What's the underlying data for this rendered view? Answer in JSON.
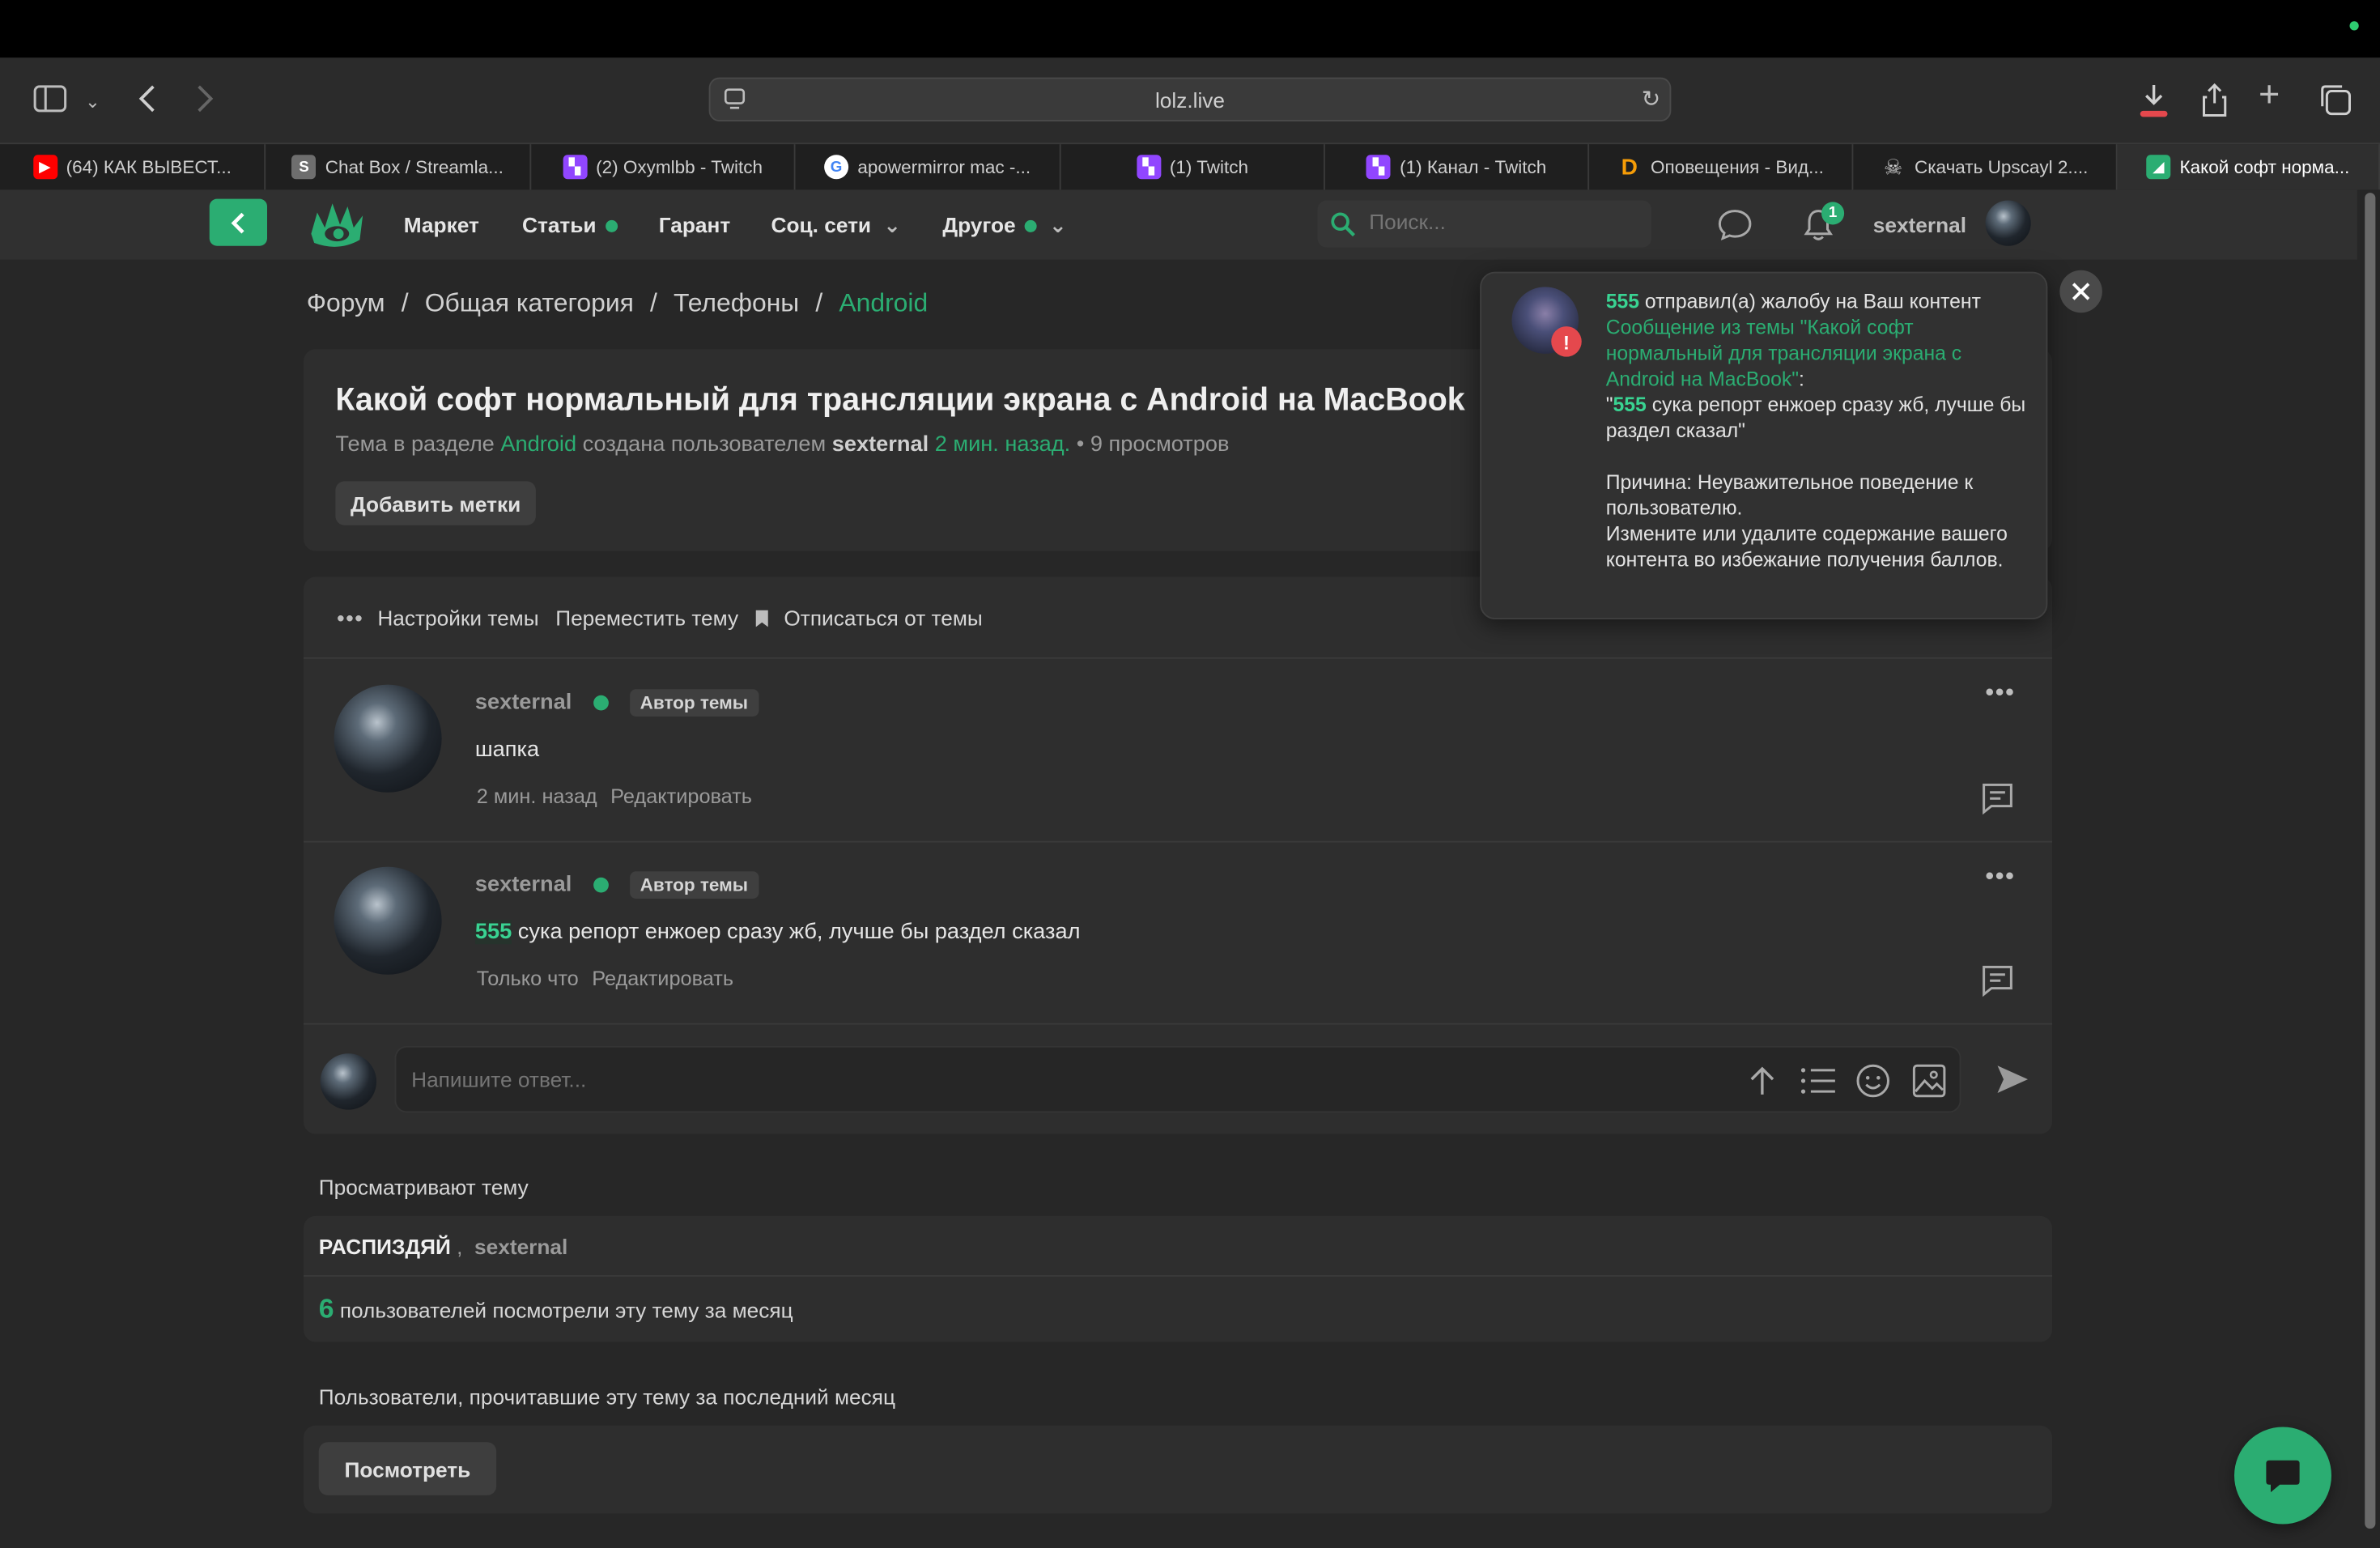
{
  "browser": {
    "url": "lolz.live",
    "tabs": [
      {
        "label": "(64) КАК ВЫВЕСТ...",
        "icon": "youtube-icon",
        "color": "#ff0000"
      },
      {
        "label": "Chat Box / Streamla...",
        "icon": "streamlabs-icon",
        "color": "#6e6e6e"
      },
      {
        "label": "(2) Oxymlbb - Twitch",
        "icon": "twitch-icon",
        "color": "#9146ff"
      },
      {
        "label": "apowermirror mac -...",
        "icon": "google-icon",
        "color": "#ffffff"
      },
      {
        "label": "(1) Twitch",
        "icon": "twitch-icon",
        "color": "#9146ff"
      },
      {
        "label": "(1) Канал - Twitch",
        "icon": "twitch-icon",
        "color": "#9146ff"
      },
      {
        "label": "Оповещения - Вид...",
        "icon": "donationalerts-icon",
        "color": "#f59c07"
      },
      {
        "label": "Скачать Upscayl 2....",
        "icon": "skull-icon",
        "color": "#444444"
      },
      {
        "label": "Какой софт норма...",
        "icon": "lolz-icon",
        "color": "#2bad72"
      }
    ]
  },
  "site": {
    "accent": "#2bad72",
    "nav": {
      "market": "Маркет",
      "articles": "Статьи",
      "garant": "Гарант",
      "social": "Соц. сети",
      "other": "Другое"
    },
    "search_placeholder": "Поиск...",
    "notif_count": "1",
    "username": "sexternal"
  },
  "breadcrumb": {
    "items": [
      "Форум",
      "Общая категория",
      "Телефоны"
    ],
    "current": "Android",
    "sep": "/"
  },
  "thread": {
    "title": "Какой софт нормальный для трансляции экрана с Android на MacBook",
    "meta_prefix": "Тема в разделе",
    "section": "Android",
    "meta_mid": "создана пользователем",
    "author": "sexternal",
    "time": "2 мин. назад.",
    "views": "• 9 просмотров",
    "add_tags": "Добавить метки"
  },
  "thread_actions": {
    "settings": "Настройки темы",
    "move": "Переместить тему",
    "unsubscribe": "Отписаться от темы"
  },
  "posts": [
    {
      "author": "sexternal",
      "badge": "Автор темы",
      "mention": "",
      "text": "шапка",
      "time": "2 мин. назад",
      "edit": "Редактировать"
    },
    {
      "author": "sexternal",
      "badge": "Автор темы",
      "mention": "555",
      "text": " сука репорт енжоер сразу жб, лучше бы раздел сказал",
      "time": "Только что",
      "edit": "Редактировать"
    }
  ],
  "reply": {
    "placeholder": "Напишите ответ..."
  },
  "viewers": {
    "heading": "Просматривают тему",
    "users": [
      "РАСПИЗДЯЙ",
      "sexternal"
    ],
    "count": "6",
    "count_text": "пользователей посмотрели эту тему за месяц"
  },
  "readers": {
    "heading": "Пользователи, прочитавшие эту тему за последний месяц",
    "button": "Посмотреть"
  },
  "notification": {
    "user": "555",
    "action": " отправил(а) жалобу на Ваш контент",
    "link": "Сообщение из темы \"Какой софт нормальный для трансляции экрана с Android на MacBook\"",
    "colon": ":",
    "quote_open": "\"",
    "quote_user": "555",
    "quote_text": " сука репорт енжоер сразу жб, лучше бы раздел сказал\"",
    "reason": "Причина: Неуважительное поведение к пользователю.",
    "advice": "Измените или удалите содержание вашего контента во избежание получения баллов."
  }
}
